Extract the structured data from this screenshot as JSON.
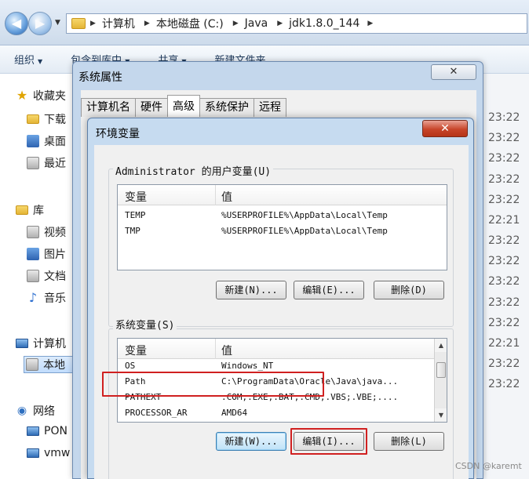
{
  "explorer": {
    "breadcrumb": [
      "计算机",
      "本地磁盘 (C:)",
      "Java",
      "jdk1.8.0_144"
    ],
    "toolbar": [
      "组织",
      "包含到库中",
      "共享",
      "新建文件夹"
    ],
    "sidebar": {
      "favorites": "收藏夹",
      "downloads": "下载",
      "desktop": "桌面",
      "recent": "最近",
      "libraries": "库",
      "videos": "视频",
      "pictures": "图片",
      "documents": "文档",
      "music": "音乐",
      "computer": "计算机",
      "local_disk": "本地",
      "network": "网络",
      "pc1": "PON",
      "pc2": "vmw"
    },
    "times": [
      "23:22",
      "23:22",
      "23:22",
      "23:22",
      "23:22",
      "22:21",
      "23:22",
      "23:22",
      "23:22",
      "23:22",
      "23:22",
      "22:21",
      "23:22",
      "23:22"
    ]
  },
  "system_properties": {
    "title": "系统属性",
    "tabs": [
      "计算机名",
      "硬件",
      "高级",
      "系统保护",
      "远程"
    ]
  },
  "env_dialog": {
    "title": "环境变量",
    "close_glyph": "✕",
    "user_group_label": "Administrator 的用户变量(U)",
    "user_columns": {
      "var": "变量",
      "val": "值"
    },
    "user_vars": [
      {
        "name": "TEMP",
        "value": "%USERPROFILE%\\AppData\\Local\\Temp"
      },
      {
        "name": "TMP",
        "value": "%USERPROFILE%\\AppData\\Local\\Temp"
      }
    ],
    "user_buttons": {
      "new": "新建(N)...",
      "edit": "编辑(E)...",
      "delete": "删除(D)"
    },
    "system_group_label": "系统变量(S)",
    "system_columns": {
      "var": "变量",
      "val": "值"
    },
    "system_vars": [
      {
        "name": "OS",
        "value": "Windows_NT"
      },
      {
        "name": "Path",
        "value": "C:\\ProgramData\\Oracle\\Java\\java..."
      },
      {
        "name": "PATHEXT",
        "value": ".COM;.EXE;.BAT;.CMD;.VBS;.VBE;...."
      },
      {
        "name": "PROCESSOR_AR",
        "value": "AMD64"
      }
    ],
    "system_buttons": {
      "new": "新建(W)...",
      "edit": "编辑(I)...",
      "delete": "删除(L)"
    }
  },
  "watermark": "CSDN @karemt",
  "colors": {
    "highlight_box": "#d02020"
  }
}
